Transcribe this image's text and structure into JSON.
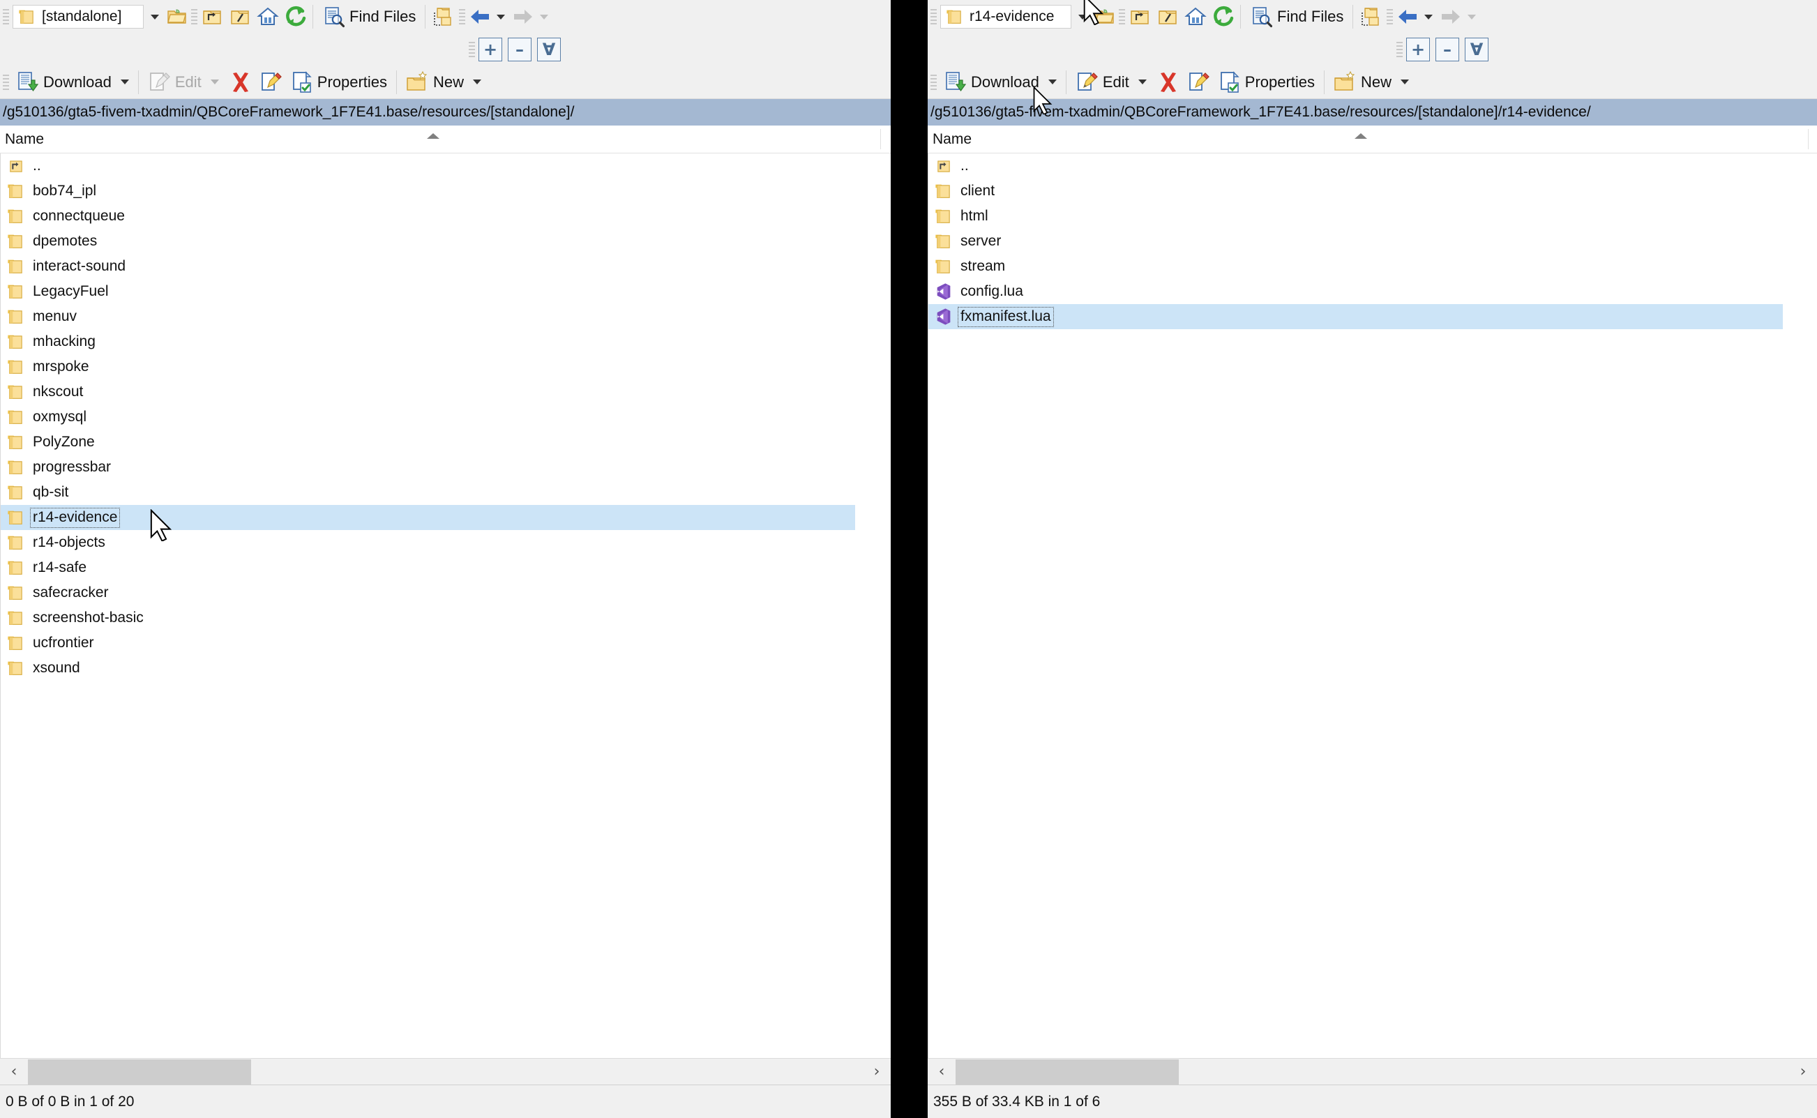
{
  "left": {
    "combo_value": "[standalone]",
    "toolbar_top": {
      "find_files_label": "Find Files"
    },
    "toolbar_main": {
      "download_label": "Download",
      "edit_label": "Edit",
      "edit_enabled": false,
      "properties_label": "Properties",
      "new_label": "New"
    },
    "zoom_buttons": {
      "plus": "+",
      "minus": "–",
      "fit": "∀"
    },
    "path": "/g510136/gta5-fivem-txadmin/QBCoreFramework_1F7E41.base/resources/[standalone]/",
    "column_header": "Name",
    "items": [
      {
        "name": "..",
        "type": "parent",
        "selected": false
      },
      {
        "name": "bob74_ipl",
        "type": "folder",
        "selected": false
      },
      {
        "name": "connectqueue",
        "type": "folder",
        "selected": false
      },
      {
        "name": "dpemotes",
        "type": "folder",
        "selected": false
      },
      {
        "name": "interact-sound",
        "type": "folder",
        "selected": false
      },
      {
        "name": "LegacyFuel",
        "type": "folder",
        "selected": false
      },
      {
        "name": "menuv",
        "type": "folder",
        "selected": false
      },
      {
        "name": "mhacking",
        "type": "folder",
        "selected": false
      },
      {
        "name": "mrspoke",
        "type": "folder",
        "selected": false
      },
      {
        "name": "nkscout",
        "type": "folder",
        "selected": false
      },
      {
        "name": "oxmysql",
        "type": "folder",
        "selected": false
      },
      {
        "name": "PolyZone",
        "type": "folder",
        "selected": false
      },
      {
        "name": "progressbar",
        "type": "folder",
        "selected": false
      },
      {
        "name": "qb-sit",
        "type": "folder",
        "selected": false
      },
      {
        "name": "r14-evidence",
        "type": "folder",
        "selected": true
      },
      {
        "name": "r14-objects",
        "type": "folder",
        "selected": false
      },
      {
        "name": "r14-safe",
        "type": "folder",
        "selected": false
      },
      {
        "name": "safecracker",
        "type": "folder",
        "selected": false
      },
      {
        "name": "screenshot-basic",
        "type": "folder",
        "selected": false
      },
      {
        "name": "ucfrontier",
        "type": "folder",
        "selected": false
      },
      {
        "name": "xsound",
        "type": "folder",
        "selected": false
      }
    ],
    "status": "0 B of 0 B in 1 of 20"
  },
  "right": {
    "combo_value": "r14-evidence",
    "toolbar_top": {
      "find_files_label": "Find Files"
    },
    "toolbar_main": {
      "download_label": "Download",
      "edit_label": "Edit",
      "edit_enabled": true,
      "properties_label": "Properties",
      "new_label": "New"
    },
    "zoom_buttons": {
      "plus": "+",
      "minus": "–",
      "fit": "∀"
    },
    "path": "/g510136/gta5-fivem-txadmin/QBCoreFramework_1F7E41.base/resources/[standalone]/r14-evidence/",
    "column_header": "Name",
    "items": [
      {
        "name": "..",
        "type": "parent",
        "selected": false
      },
      {
        "name": "client",
        "type": "folder",
        "selected": false
      },
      {
        "name": "html",
        "type": "folder",
        "selected": false
      },
      {
        "name": "server",
        "type": "folder",
        "selected": false
      },
      {
        "name": "stream",
        "type": "folder",
        "selected": false
      },
      {
        "name": "config.lua",
        "type": "lua",
        "selected": false
      },
      {
        "name": "fxmanifest.lua",
        "type": "lua",
        "selected": true
      }
    ],
    "status": "355 B of 33.4 KB in 1 of 6"
  },
  "colors": {
    "pathbar_bg": "#a4b8d2",
    "selection_bg": "#cce4f7",
    "toolbar_bg": "#f0f0f0",
    "folder_icon": "#f7d272",
    "lua_icon": "#7c4dbe",
    "back_arrow": "#3a6fc4",
    "forward_arrow": "#bdbdbd",
    "delete_red": "#d8362a",
    "refresh_green": "#38a838"
  }
}
